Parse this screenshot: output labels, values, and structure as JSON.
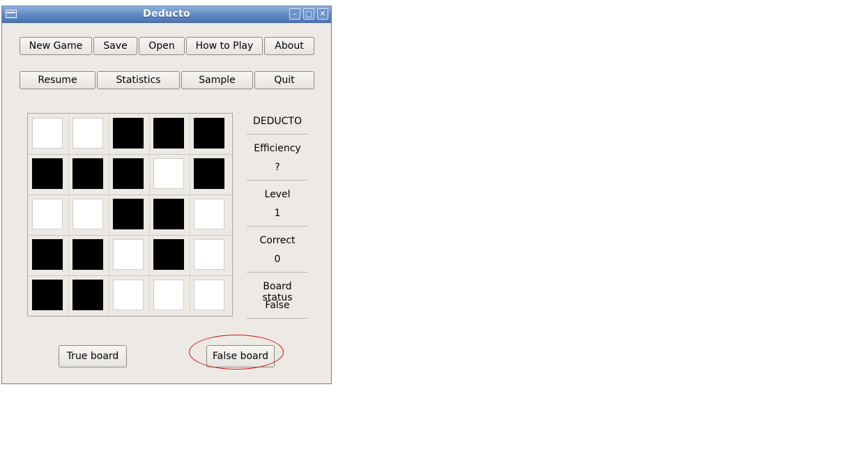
{
  "window": {
    "title": "Deducto"
  },
  "toolbar_row1": [
    {
      "label": "New Game"
    },
    {
      "label": "Save"
    },
    {
      "label": "Open"
    },
    {
      "label": "How to Play"
    },
    {
      "label": "About"
    }
  ],
  "toolbar_row2": [
    {
      "label": "Resume"
    },
    {
      "label": "Statistics"
    },
    {
      "label": "Sample"
    },
    {
      "label": "Quit"
    }
  ],
  "board": {
    "rows": [
      [
        "white",
        "white",
        "black",
        "black",
        "black"
      ],
      [
        "black",
        "black",
        "black",
        "white",
        "black"
      ],
      [
        "white",
        "white",
        "black",
        "black",
        "white"
      ],
      [
        "black",
        "black",
        "white",
        "black",
        "white"
      ],
      [
        "black",
        "black",
        "white",
        "white",
        "white"
      ]
    ]
  },
  "status": {
    "game_name": "DEDUCTO",
    "efficiency_label": "Efficiency",
    "efficiency_value": "?",
    "level_label": "Level",
    "level_value": "1",
    "correct_label": "Correct",
    "correct_value": "0",
    "board_status_label": "Board status",
    "board_status_value": "False"
  },
  "actions": {
    "true_board": "True board",
    "false_board": "False board"
  },
  "colors": {
    "titlebar": "#5e87c2",
    "window_bg": "#edeae5",
    "annotation_circle": "#d01010"
  }
}
